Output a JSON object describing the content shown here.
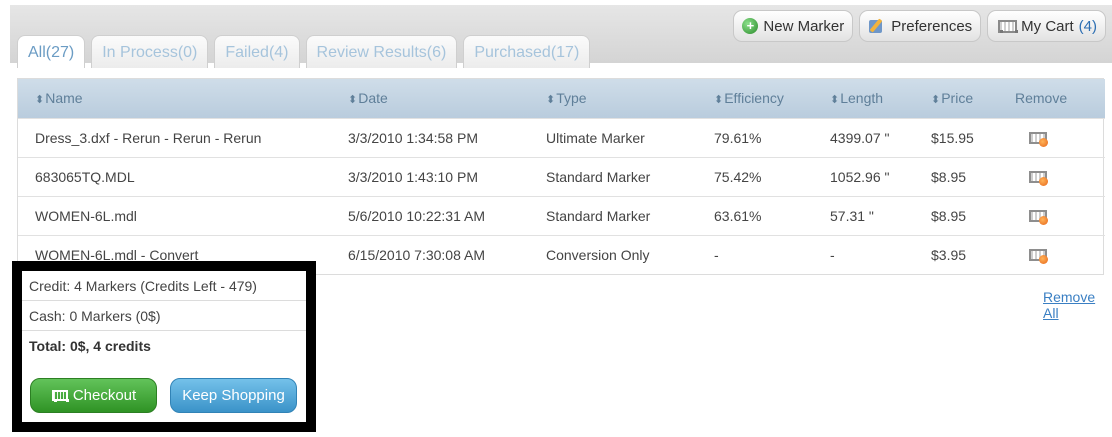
{
  "tabs": [
    {
      "label": "All(27)",
      "active": true
    },
    {
      "label": "In Process(0)",
      "active": false
    },
    {
      "label": "Failed(4)",
      "active": false
    },
    {
      "label": "Review Results(6)",
      "active": false
    },
    {
      "label": "Purchased(17)",
      "active": false
    }
  ],
  "toolbar": {
    "new_marker": "New Marker",
    "preferences": "Preferences",
    "my_cart": "My Cart",
    "cart_count": "(4)"
  },
  "table": {
    "sort_glyph": "⬍",
    "headers": [
      "Name",
      "Date",
      "Type",
      "Efficiency",
      "Length",
      "Price",
      "Remove"
    ],
    "rows": [
      {
        "name": "Dress_3.dxf - Rerun - Rerun - Rerun",
        "date": "3/3/2010 1:34:58 PM",
        "type": "Ultimate Marker",
        "efficiency": "79.61%",
        "length": "4399.07 \"",
        "price": "$15.95"
      },
      {
        "name": "683065TQ.MDL",
        "date": "3/3/2010 1:43:10 PM",
        "type": "Standard Marker",
        "efficiency": "75.42%",
        "length": "1052.96 \"",
        "price": "$8.95"
      },
      {
        "name": "WOMEN-6L.mdl",
        "date": "5/6/2010 10:22:31 AM",
        "type": "Standard Marker",
        "efficiency": "63.61%",
        "length": "57.31 \"",
        "price": "$8.95"
      },
      {
        "name": "WOMEN-6L.mdl - Convert",
        "date": "6/15/2010 7:30:08 AM",
        "type": "Conversion Only",
        "efficiency": "-",
        "length": "-",
        "price": "$3.95"
      }
    ]
  },
  "remove_all": "Remove All",
  "summary": {
    "credit": "Credit: 4 Markers (Credits Left - 479)",
    "cash": "Cash: 0 Markers (0$)",
    "total": "Total: 0$, 4 credits",
    "checkout": "Checkout",
    "keep_shopping": "Keep Shopping"
  },
  "colors": {
    "header_bg": "#c3d4e3",
    "tab_text": "#a6c4dc",
    "link": "#3a7fc3",
    "checkout_green": "#3a9e2f",
    "keep_blue": "#4a9fd4"
  }
}
